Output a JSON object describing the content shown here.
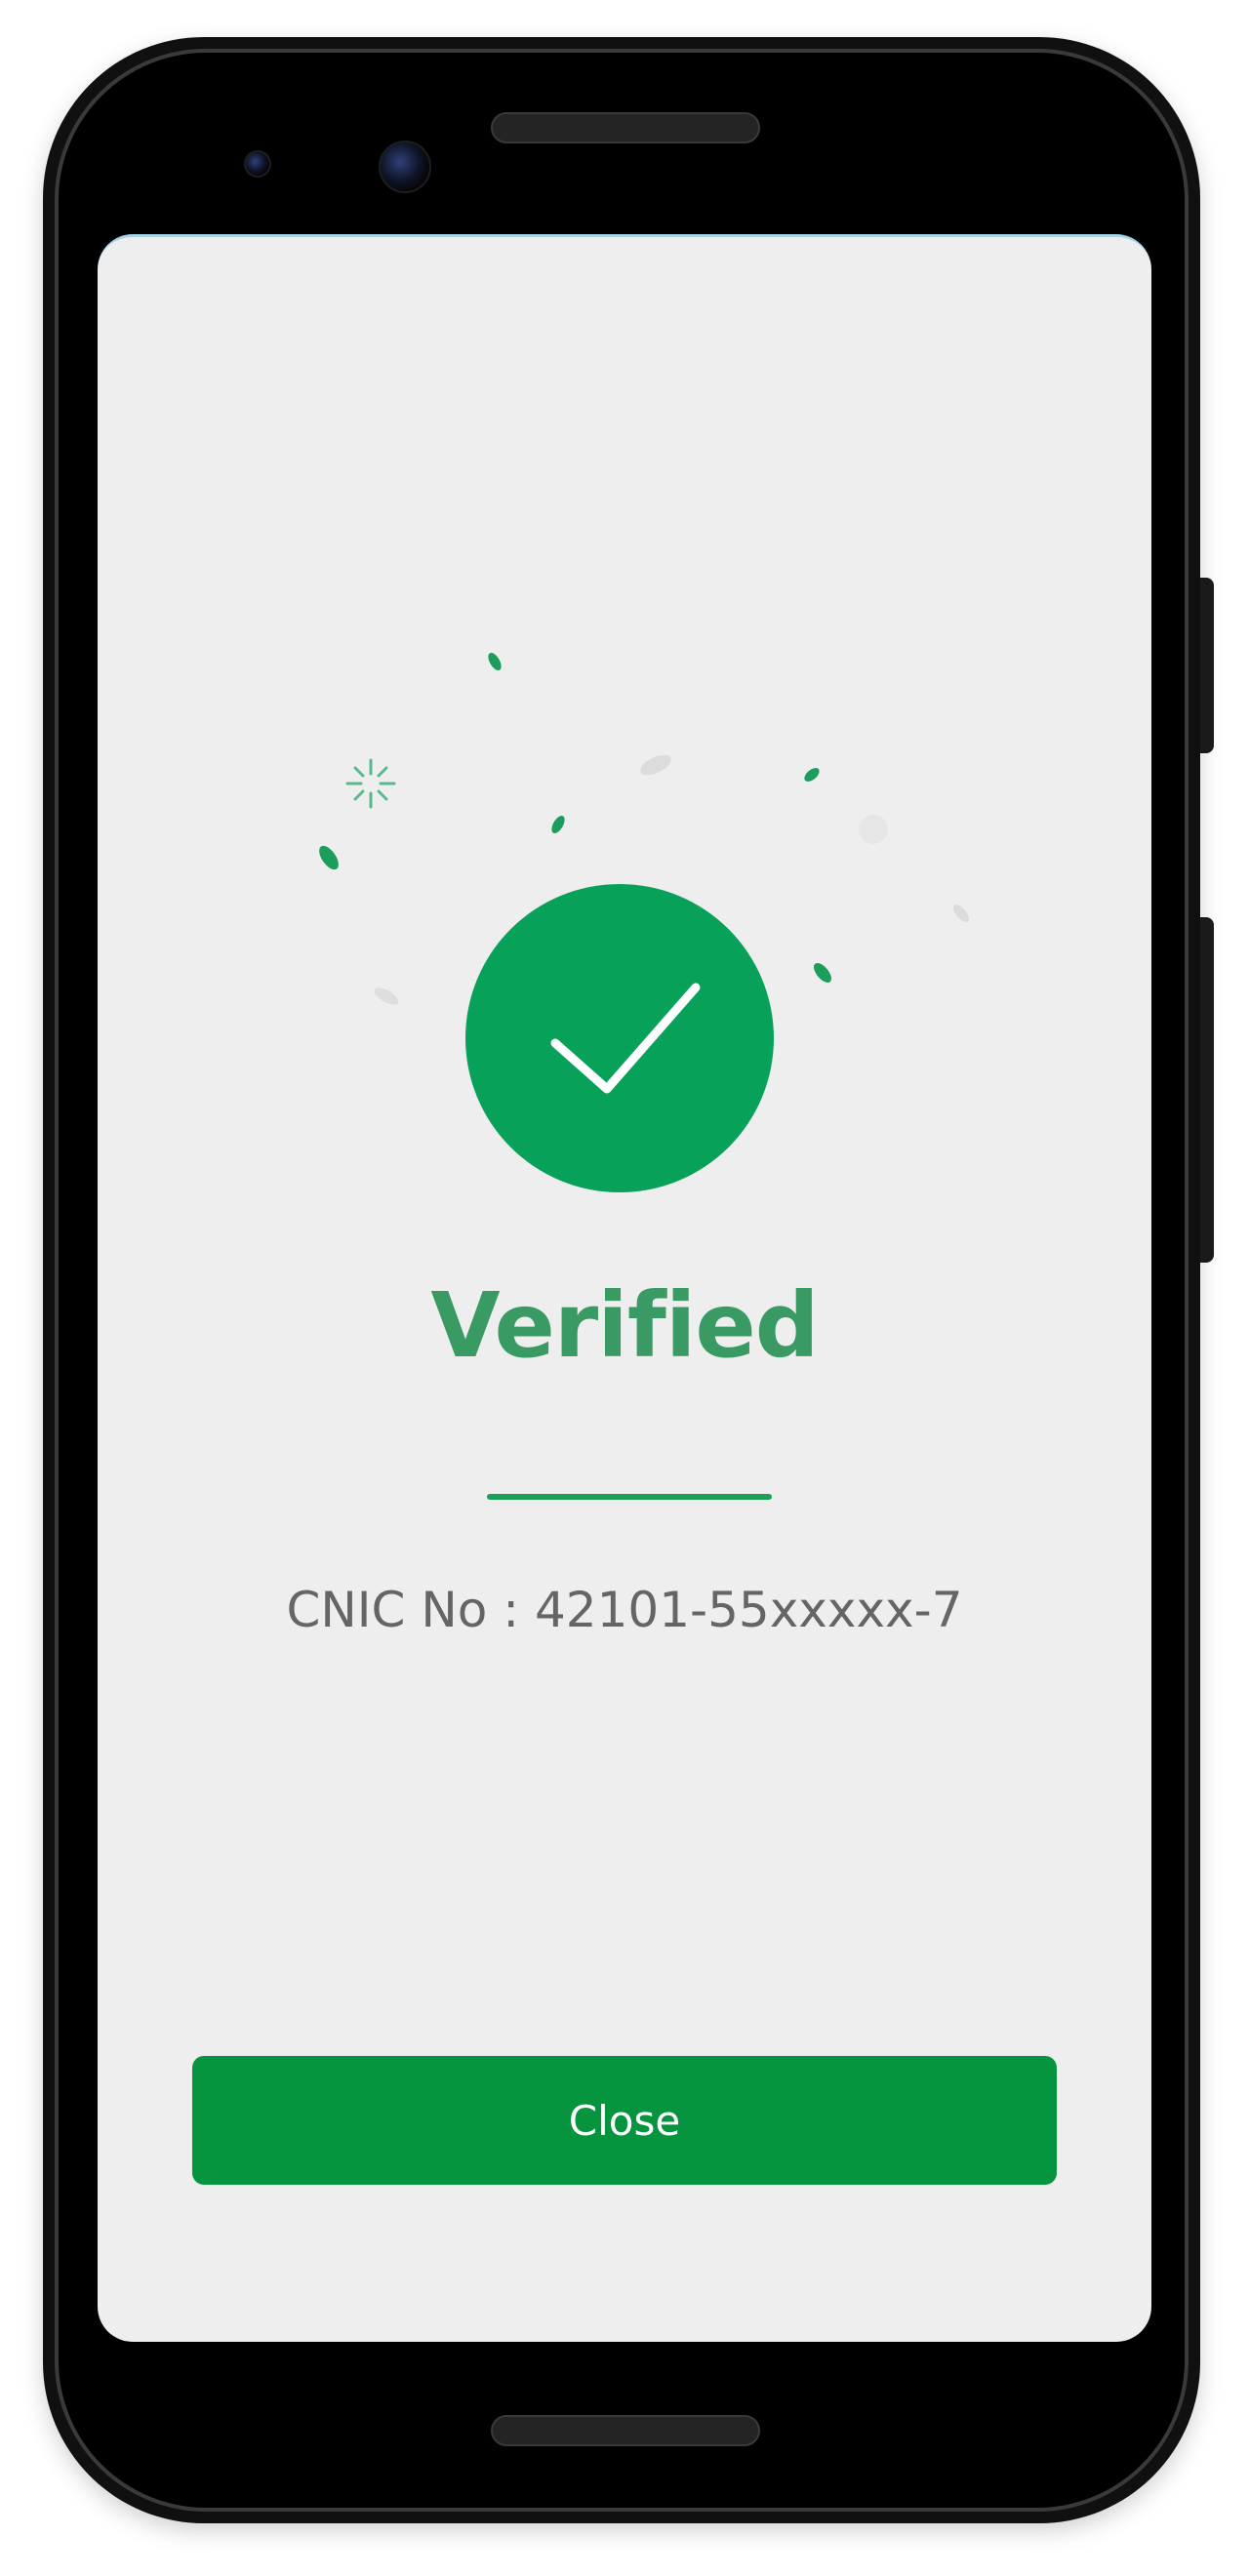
{
  "verification": {
    "title": "Verified",
    "cnic_text": "CNIC No : 42101-55xxxxx-7"
  },
  "actions": {
    "close_label": "Close"
  },
  "icons": {
    "status": "checkmark-icon",
    "decoration": "confetti"
  },
  "colors": {
    "accent_green": "#08a15a",
    "button_green": "#06943e",
    "title_green": "#3a9a63",
    "screen_background": "#eeeeee",
    "text_gray": "#656565"
  }
}
